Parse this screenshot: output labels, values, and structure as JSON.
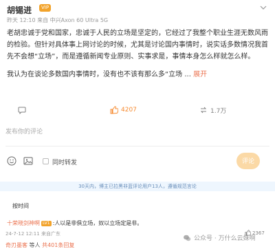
{
  "header": {
    "username": "胡锡进",
    "vip_badge": "VIP",
    "meta": "昨天 12:10 来自 中兴Axon 60 Ultra 5G"
  },
  "post": {
    "paragraph_1": "老胡忠诚于党和国家，忠诚于人民的立场是坚定的，它经过了我整个职业生涯无数风雨的检验。但针对具体事上网讨论的时候，尤其是讨论国内事情时，说实话多数情况我首先不会想“立场”，而是遵循新闻专业原则、实事求是，事情本身怎么样就怎么样。",
    "paragraph_2": "我认为在谈论多数国内事情时，没有也不该有那么多“立场 ...",
    "more_link": "展开"
  },
  "actions": {
    "comments": "",
    "likes": "4207",
    "reposts": "1.7万"
  },
  "comment_input": {
    "placeholder": "发布你的评论"
  },
  "toolbar": {
    "repost_label": "同时转发",
    "submit_label": "评论"
  },
  "notice": "30天内，博主已拉黑非蓝评论用户13人，遵循规范言论",
  "sort": {
    "label": "按时间"
  },
  "comment": {
    "name": "十荣晓剑神啊",
    "badge": "LV1",
    "text": ":人以是非俱立场，奴以立场定是非。",
    "meta": "24-7-12 12:11 来自广东",
    "likes": "2367",
    "reply_name": "奇刃墨客",
    "reply_mid": "等人",
    "reply_count": "共401条回复"
  },
  "watermark": "公众号 · 万什么云妹啊",
  "colors": {
    "accent": "#eb7350",
    "like": "#f68a2f",
    "vip": "#f2a32b",
    "submit_disabled": "#fbd9a6",
    "notice_bg": "#eef6fe",
    "notice_text": "#6a8fba"
  },
  "icons": {
    "chevron": "chevron-down-icon",
    "comment": "comment-icon",
    "like": "thumbs-up-icon",
    "repost": "repost-icon",
    "emoji": "emoji-icon",
    "image": "image-icon",
    "watermark": "wechat-icon"
  }
}
